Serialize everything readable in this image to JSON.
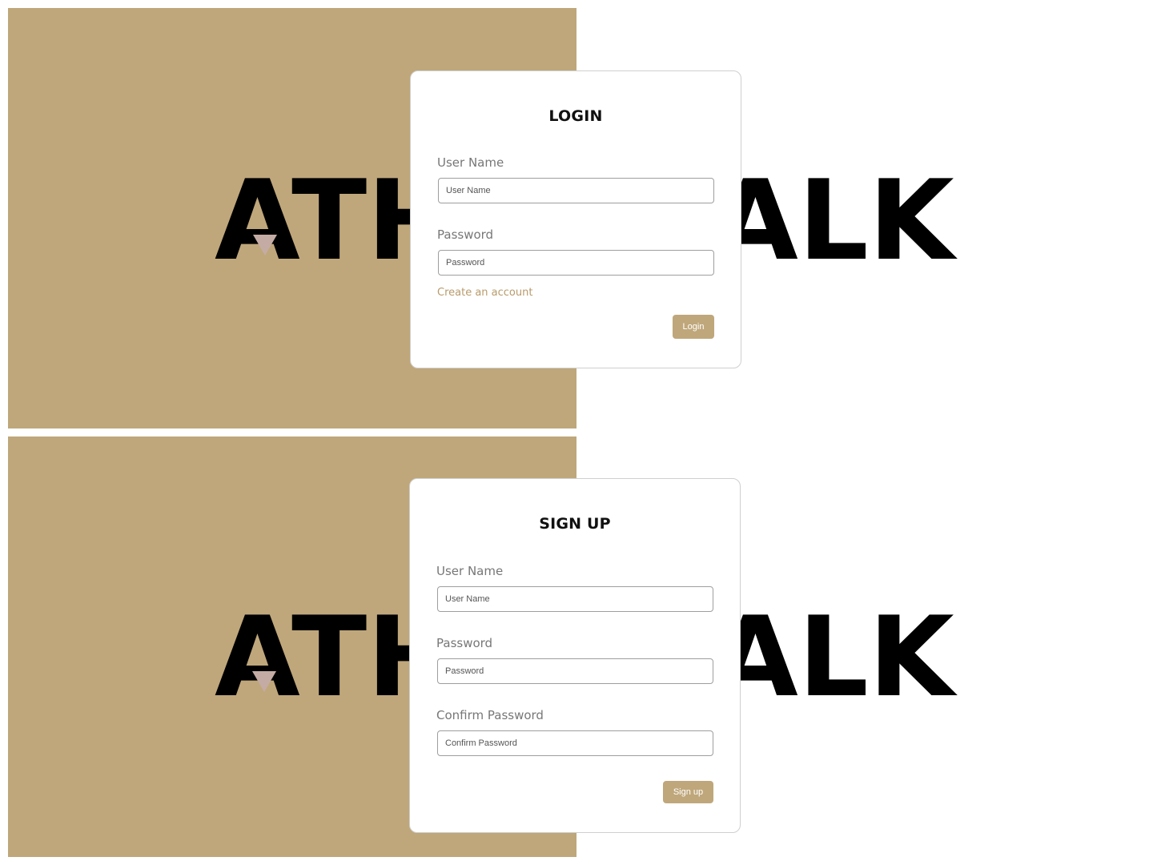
{
  "brand": {
    "logo_text_left": "ATH",
    "logo_text_right": "ALK",
    "accent_color": "#bfa77b",
    "link_color": "#b89b6a"
  },
  "login": {
    "title": "LOGIN",
    "username_label": "User Name",
    "username_placeholder": "User Name",
    "password_label": "Password",
    "password_placeholder": "Password",
    "create_account_link": "Create an account",
    "submit_label": "Login"
  },
  "signup": {
    "title": "SIGN UP",
    "username_label": "User Name",
    "username_placeholder": "User Name",
    "password_label": "Password",
    "password_placeholder": "Password",
    "confirm_label": "Confirm Password",
    "confirm_placeholder": "Confirm Password",
    "submit_label": "Sign up"
  }
}
